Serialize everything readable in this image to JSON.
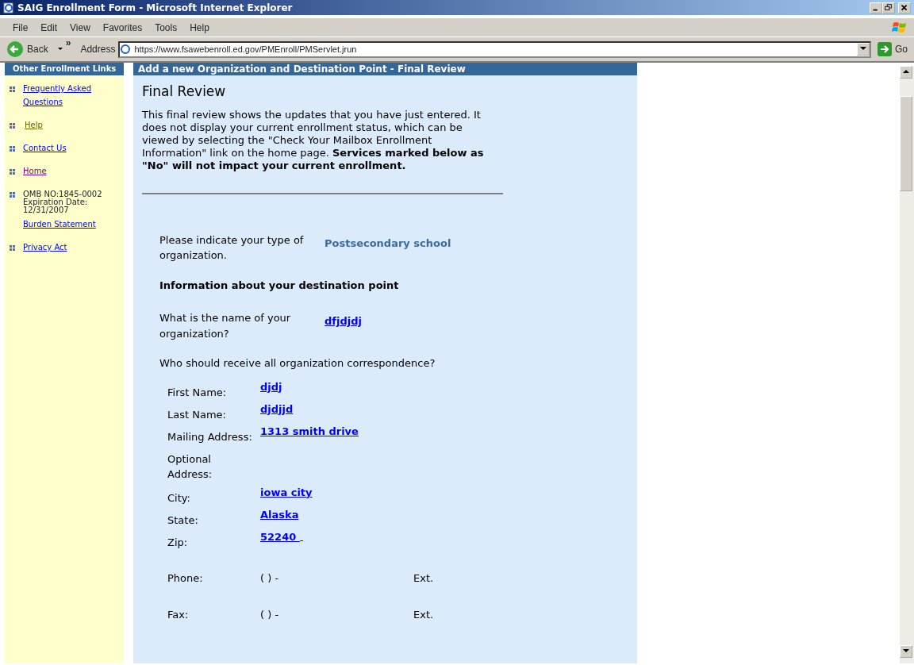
{
  "window": {
    "title": "SAIG Enrollment Form - Microsoft Internet Explorer"
  },
  "menu": [
    "File",
    "Edit",
    "View",
    "Favorites",
    "Tools",
    "Help"
  ],
  "toolbar": {
    "back": "Back",
    "more": "»",
    "address_label": "Address",
    "url": "https://www.fsawebenroll.ed.gov/PMEnroll/PMServlet.jrun",
    "go": "Go"
  },
  "sidebar": {
    "header": "Other Enrollment Links",
    "items": [
      {
        "kind": "link",
        "label": "Frequently Asked Questions",
        "visited": false,
        "hovered": false
      },
      {
        "kind": "link",
        "label": "Help",
        "visited": false,
        "hovered": true
      },
      {
        "kind": "link",
        "label": "Contact Us",
        "visited": false,
        "hovered": false
      },
      {
        "kind": "link",
        "label": "Home",
        "visited": true,
        "hovered": false
      },
      {
        "kind": "note",
        "lines": [
          "OMB NO:1845-0002",
          "Expiration Date:",
          "12/31/2007"
        ],
        "link": "Burden Statement"
      },
      {
        "kind": "link",
        "label": "Privacy Act",
        "visited": false,
        "hovered": false
      }
    ]
  },
  "main": {
    "header": "Add a new Organization and Destination Point - Final Review",
    "title": "Final Review",
    "intro": "This final review shows the updates that you have just entered. It does not display your current enrollment status, which can be viewed by selecting the \"Check Your Mailbox Enrollment Information\" link on the home page. **Services marked below as \"No\" will not impact your current enrollment.**",
    "org_type": {
      "label": "Please indicate your type of organization.",
      "value": "Postsecondary school"
    },
    "section": "Information about your destination point",
    "org_name": {
      "label": "What is the name of your organization?",
      "value": "dfjdjdj"
    },
    "question": "Who should receive all organization correspondence?",
    "contact": [
      {
        "label": "First Name:",
        "value": "djdj"
      },
      {
        "label": "Last Name:",
        "value": "djdjjd"
      },
      {
        "label": "Mailing Address:",
        "value": "1313 smith drive"
      },
      {
        "label": "Optional Address:"
      },
      {
        "label": "City:",
        "value": "iowa city"
      },
      {
        "label": "State:",
        "value": "Alaska"
      },
      {
        "label": "Zip:",
        "value": "52240 ",
        "suffix": "-"
      }
    ],
    "phones": [
      {
        "label": "Phone:",
        "value": "( ) -",
        "ext": "Ext."
      },
      {
        "label": "Fax:",
        "value": "( ) -",
        "ext": "Ext."
      }
    ]
  }
}
